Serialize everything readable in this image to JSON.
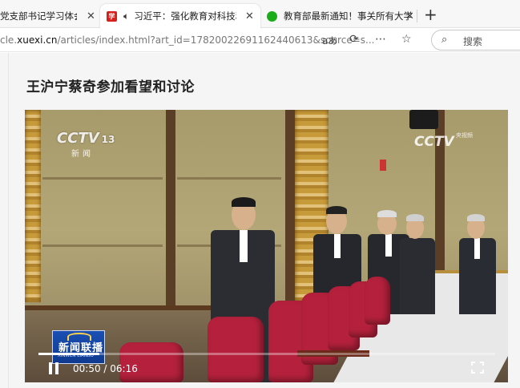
{
  "browser": {
    "tabs": [
      {
        "title": "党支部书记学习体会：务",
        "icon": "document-icon",
        "active": false
      },
      {
        "title": "习近平：强化教育对科技和人",
        "icon": "xuexi-red-icon",
        "active": true,
        "muted_audio": true
      },
      {
        "title": "教育部最新通知！事关所有大学生",
        "icon": "wechat-green-icon",
        "active": false
      }
    ],
    "close_glyph": "✕",
    "new_tab_glyph": "+",
    "address": {
      "prefix": "cle.",
      "host": "xuexi.cn",
      "path": "/articles/index.html?art_id=17820022691162440613&source=s..."
    },
    "toolbar_icons": [
      "read-aloud-icon",
      "refresh-icon",
      "more-icon",
      "favorite-star-icon"
    ],
    "read_aloud_glyph": "aあ",
    "search_placeholder": "搜索"
  },
  "article": {
    "title": "王沪宁蔡奇参加看望和讨论"
  },
  "video": {
    "channel_logo": "CCTV",
    "channel_number": "13",
    "channel_sub": "新闻",
    "watermark_logo": "CCTV",
    "watermark_sub": "央视频",
    "program_badge_cn": "新闻联播",
    "program_badge_en": "XINWEN LIANBO",
    "current_time": "00:50",
    "duration": "06:16",
    "time_display": "00:50 / 06:16",
    "progress_fraction": 0.133,
    "state": "playing"
  },
  "colors": {
    "accent_red": "#d6201b",
    "chair_red": "#b5213c",
    "news_badge_blue": "#1a4fb3"
  }
}
